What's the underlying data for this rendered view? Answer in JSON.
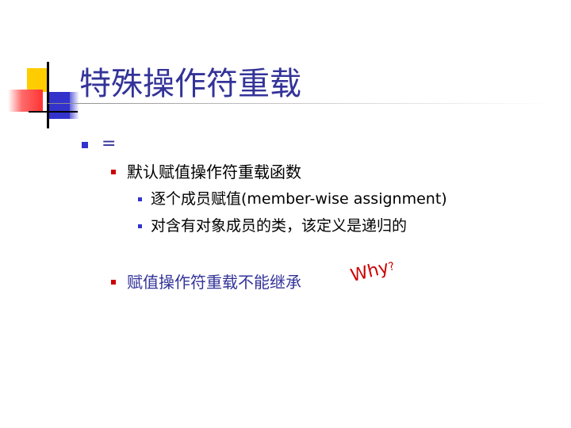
{
  "slide": {
    "title": "特殊操作符重载",
    "items": [
      {
        "level": 1,
        "text": "="
      },
      {
        "level": 2,
        "text": "默认赋值操作符重载函数"
      },
      {
        "level": 3,
        "text": "逐个成员赋值(member-wise assignment)"
      },
      {
        "level": 3,
        "text": "对含有对象成员的类，该定义是递归的"
      },
      {
        "level": 2,
        "text": "赋值操作符重载不能继承"
      }
    ],
    "annotation": {
      "text": "Why",
      "mark": "?"
    }
  },
  "colors": {
    "title": "#333399",
    "level1_bullet": "#3333cc",
    "level2_bullet": "#cc0000",
    "level3_bullet": "#3333cc",
    "annotation": "#cc0000",
    "logo_yellow": "#ffcc00",
    "logo_red": "#ff3333",
    "logo_blue": "#3333cc"
  }
}
